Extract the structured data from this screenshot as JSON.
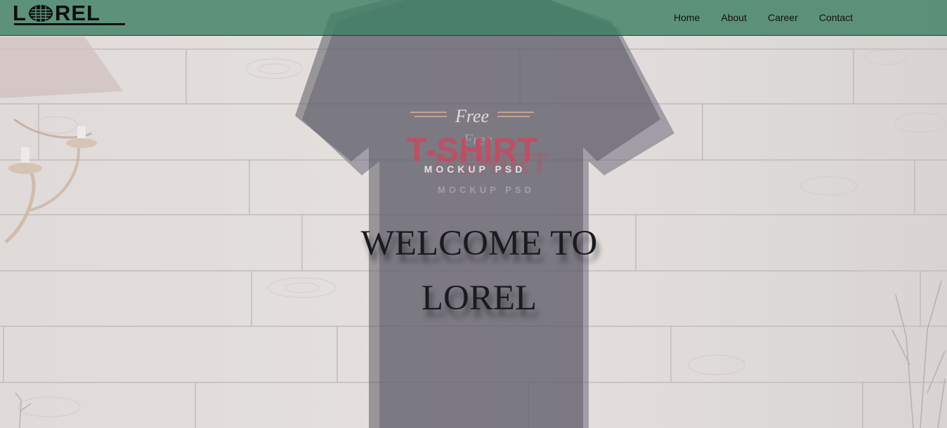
{
  "brand": {
    "name_prefix": "L",
    "name_suffix": "REL",
    "logo_icon": "globe-mark-icon"
  },
  "nav": {
    "items": [
      {
        "label": "Home"
      },
      {
        "label": "About"
      },
      {
        "label": "Career"
      },
      {
        "label": "Contact"
      }
    ]
  },
  "hero": {
    "title_line1": "WELCOME TO",
    "title_line2": "LOREL",
    "shirt_print": {
      "script": "Free",
      "big": "T-SHIRT",
      "small": "MOCKUP PSD"
    }
  },
  "colors": {
    "navbar": "#408064",
    "shirt": "#4f4b5c",
    "print_red": "#c0304a",
    "wood": "#d9d4d2"
  }
}
